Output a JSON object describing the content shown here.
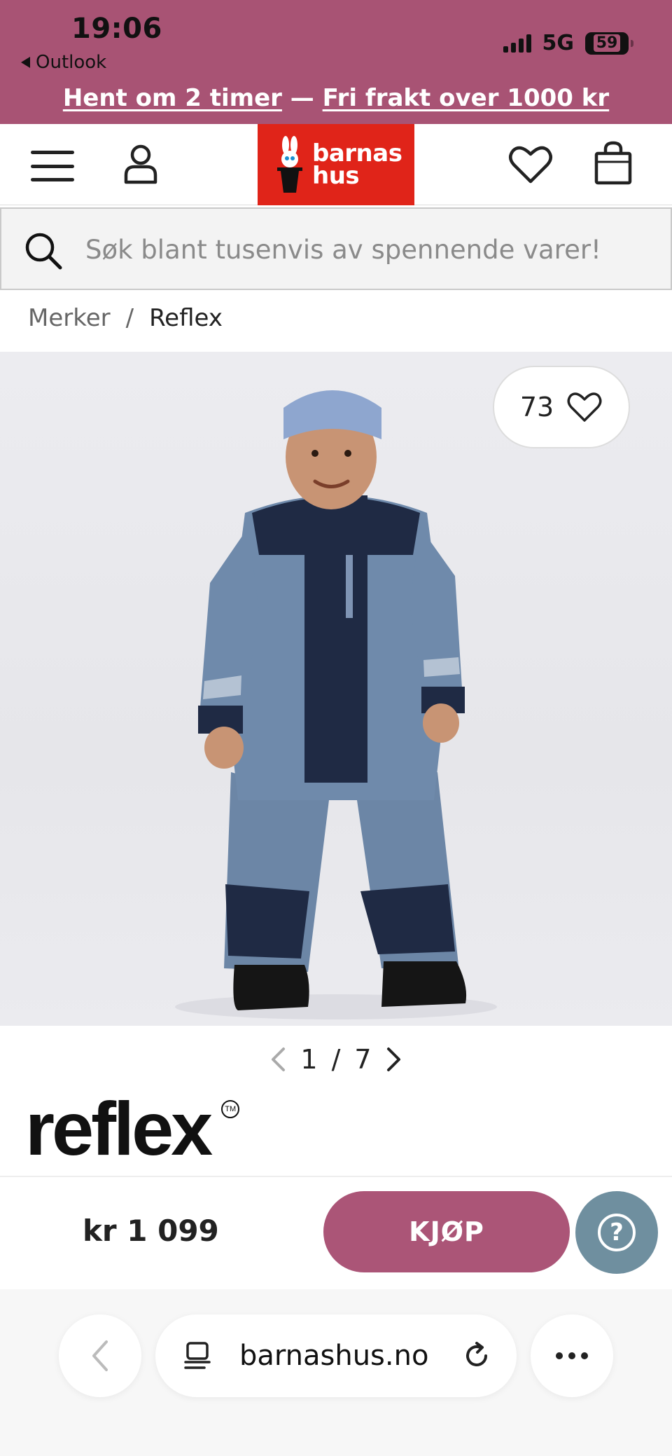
{
  "status": {
    "time": "19:06",
    "back_app": "Outlook",
    "network": "5G",
    "battery": "59"
  },
  "promo": {
    "part1": "Hent om 2 timer",
    "separator": "—",
    "part2": "Fri frakt over 1000 kr"
  },
  "header": {
    "logo_line1": "barnas",
    "logo_line2": "hus"
  },
  "search": {
    "placeholder": "Søk blant tusenvis av spennende varer!"
  },
  "breadcrumb": {
    "items": [
      "Merker",
      "Reflex"
    ],
    "separator": "/"
  },
  "product": {
    "likes": "73",
    "image_index": "1",
    "image_total": "7",
    "image_sep": "/",
    "brand": "reflex",
    "price": "kr 1 099",
    "buy_label": "KJØP"
  },
  "help": {
    "label": "?"
  },
  "browser": {
    "url": "barnashus.no"
  },
  "colors": {
    "brand_pink": "#a85374",
    "buy_button": "#ab5577",
    "logo_red": "#e02419",
    "help_button": "#6f8f9f"
  },
  "icons": [
    "hamburger-icon",
    "user-icon",
    "heart-icon",
    "bag-icon",
    "search-icon",
    "chevron-left-icon",
    "chevron-right-icon",
    "question-icon",
    "tabs-icon",
    "reload-icon",
    "more-icon"
  ]
}
